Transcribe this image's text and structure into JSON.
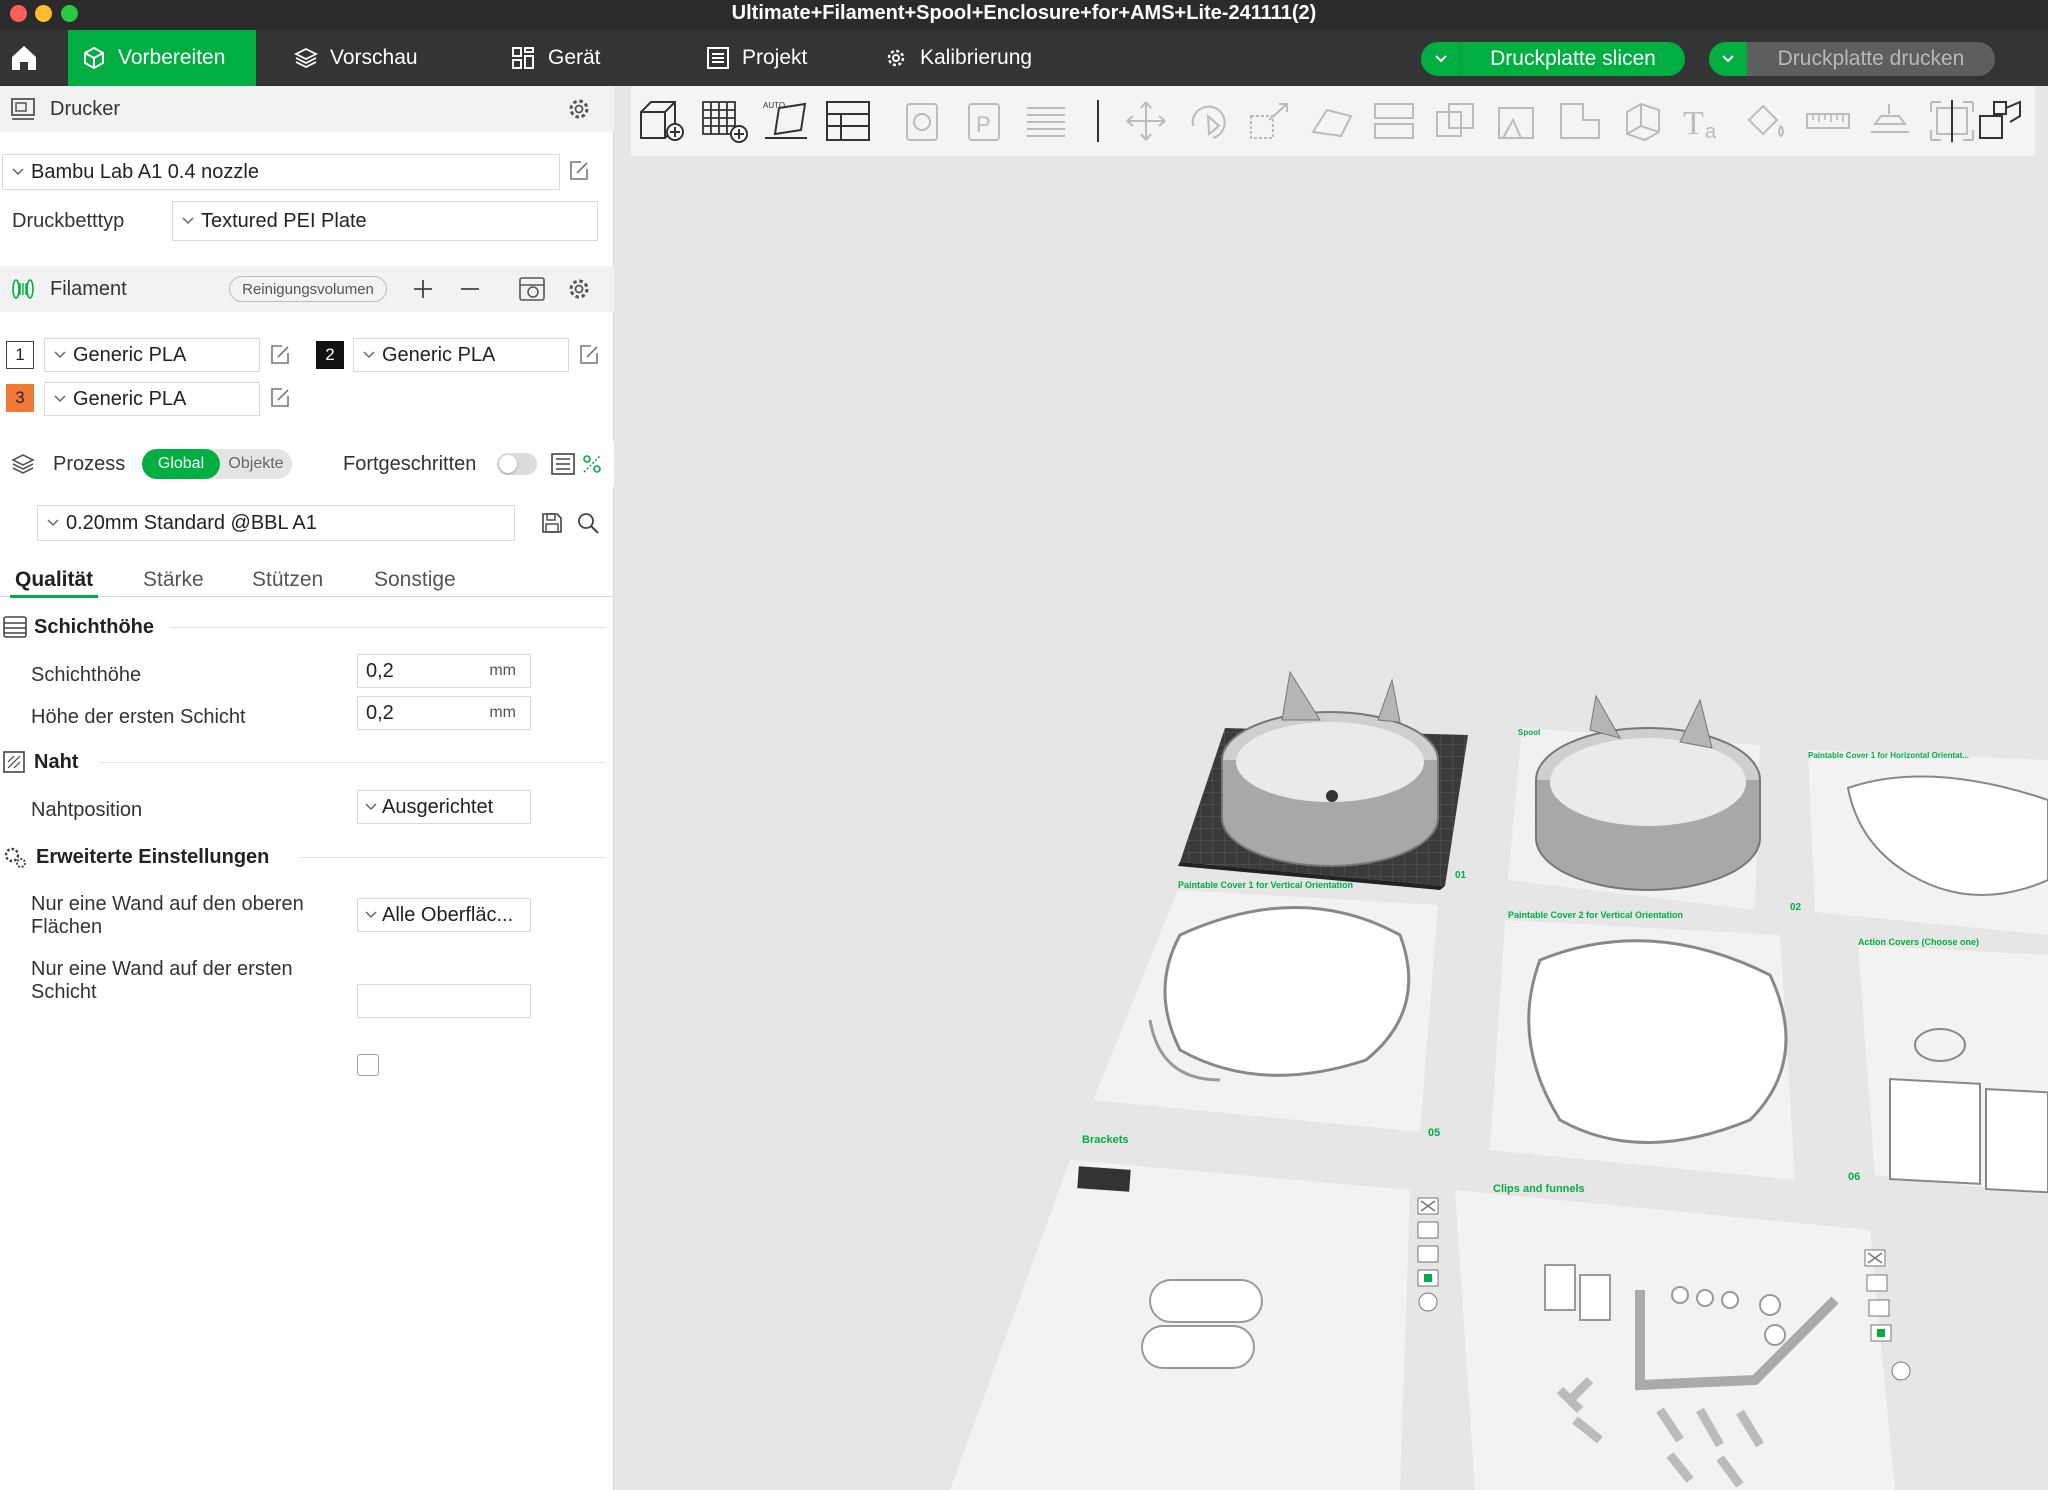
{
  "window": {
    "title": "Ultimate+Filament+Spool+Enclosure+for+AMS+Lite-241111(2)"
  },
  "tabs": [
    {
      "label": "Vorbereiten",
      "icon": "cube-icon"
    },
    {
      "label": "Vorschau",
      "icon": "layers-icon"
    },
    {
      "label": "Gerät",
      "icon": "device-icon"
    },
    {
      "label": "Projekt",
      "icon": "list-icon"
    },
    {
      "label": "Kalibrierung",
      "icon": "calibration-icon"
    }
  ],
  "actions": {
    "slice": "Druckplatte slicen",
    "print": "Druckplatte drucken"
  },
  "printer": {
    "title": "Drucker",
    "selected": "Bambu Lab A1 0.4 nozzle",
    "bed_label": "Druckbetttyp",
    "bed_value": "Textured PEI Plate"
  },
  "filament": {
    "title": "Filament",
    "flush_label": "Reinigungsvolumen",
    "items": [
      {
        "num": "1",
        "name": "Generic PLA",
        "color": "#ffffff"
      },
      {
        "num": "2",
        "name": "Generic PLA",
        "color": "#111111"
      },
      {
        "num": "3",
        "name": "Generic PLA",
        "color": "#f07a35"
      }
    ]
  },
  "process": {
    "title": "Prozess",
    "mode_global": "Global",
    "mode_objects": "Objekte",
    "advanced_label": "Fortgeschritten",
    "preset": "0.20mm Standard @BBL A1"
  },
  "subtabs": [
    "Qualität",
    "Stärke",
    "Stützen",
    "Sonstige"
  ],
  "settings": {
    "layer_group": "Schichthöhe",
    "layer_height_label": "Schichthöhe",
    "layer_height_value": "0,2",
    "first_layer_label": "Höhe der ersten Schicht",
    "first_layer_value": "0,2",
    "unit": "mm",
    "seam_group": "Naht",
    "seam_label": "Nahtposition",
    "seam_value": "Ausgerichtet",
    "advanced_group": "Erweiterte Einstellungen",
    "top_wall_label": "Nur eine Wand auf den oberen Flächen",
    "top_wall_value": "Alle Oberfläc...",
    "first_wall_label": "Nur eine Wand auf der ersten Schicht"
  },
  "plates": [
    {
      "label": "",
      "num": "01"
    },
    {
      "label": "Spool",
      "num": "02"
    },
    {
      "label": "Paintable Cover 1 for Horizontal Orientat...",
      "num": ""
    },
    {
      "label": "Paintable Cover 1 for Vertical Orientation",
      "num": "05"
    },
    {
      "label": "Paintable Cover 2 for Vertical Orientation",
      "num": "06"
    },
    {
      "label": "Action Covers (Choose one)",
      "num": ""
    },
    {
      "label": "Brackets",
      "num": ""
    },
    {
      "label": "Clips and funnels",
      "num": ""
    }
  ],
  "colors": {
    "accent": "#00ae42",
    "toolbar": "#343434",
    "titlebar": "#2b2b2b"
  }
}
